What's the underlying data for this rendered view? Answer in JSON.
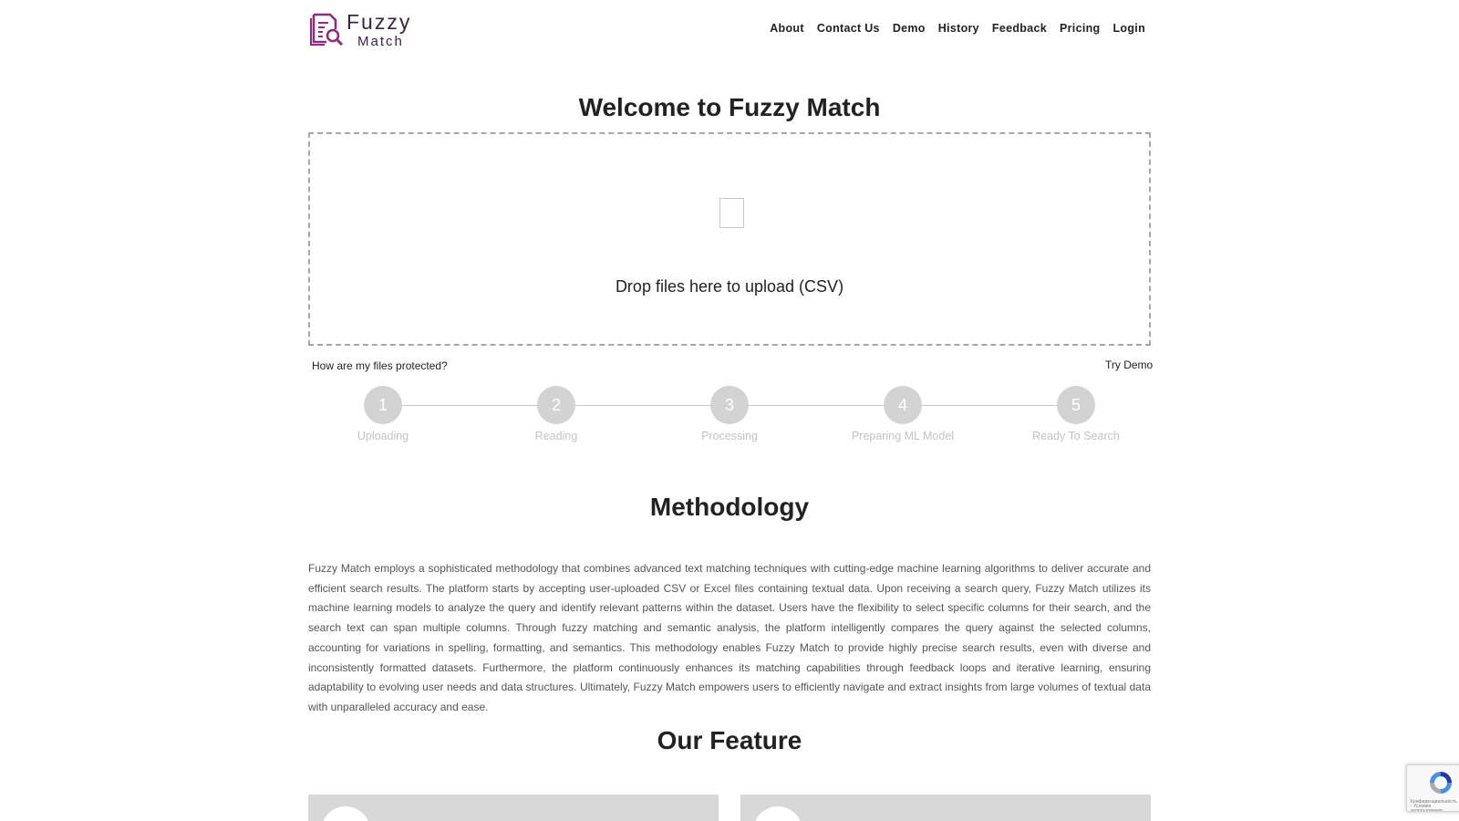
{
  "header": {
    "logo": {
      "title": "Fuzzy",
      "subtitle": "Match"
    },
    "nav": [
      {
        "label": "About"
      },
      {
        "label": "Contact Us"
      },
      {
        "label": "Demo"
      },
      {
        "label": "History"
      },
      {
        "label": "Feedback"
      },
      {
        "label": "Pricing"
      },
      {
        "label": "Login"
      }
    ]
  },
  "hero": {
    "title": "Welcome to Fuzzy Match",
    "dropzone_text": "Drop files here to upload (CSV)",
    "protect_link": "How are my files protected?",
    "try_demo_link": "Try Demo"
  },
  "steps": [
    {
      "number": "1",
      "label": "Uploading"
    },
    {
      "number": "2",
      "label": "Reading"
    },
    {
      "number": "3",
      "label": "Processing"
    },
    {
      "number": "4",
      "label": "Preparing ML Model"
    },
    {
      "number": "5",
      "label": "Ready To Search"
    }
  ],
  "methodology": {
    "title": "Methodology",
    "text": "Fuzzy Match employs a sophisticated methodology that combines advanced text matching techniques with cutting-edge machine learning algorithms to deliver accurate and efficient search results. The platform starts by accepting user-uploaded CSV or Excel files containing textual data. Upon receiving a search query, Fuzzy Match utilizes its machine learning models to analyze the query and identify relevant patterns within the dataset. Users have the flexibility to select specific columns for their search, and the search text can span multiple columns. Through fuzzy matching and semantic analysis, the platform intelligently compares the query against the selected columns, accounting for variations in spelling, formatting, and semantics. This methodology enables Fuzzy Match to provide highly precise search results, even with diverse and inconsistently formatted datasets. Furthermore, the platform continuously enhances its matching capabilities through feedback loops and iterative learning, ensuring adaptability to evolving user needs and data structures. Ultimately, Fuzzy Match empowers users to efficiently navigate and extract insights from large volumes of textual data with unparalleled accuracy and ease."
  },
  "features": {
    "title": "Our Feature"
  },
  "recaptcha": {
    "text": "Конфиденциальность - Условия использования"
  },
  "colors": {
    "brand": "#7a2a6e",
    "step_circle": "#d3d3d3",
    "step_label": "#c3c3c3",
    "card_bg": "#d8d8d8"
  }
}
